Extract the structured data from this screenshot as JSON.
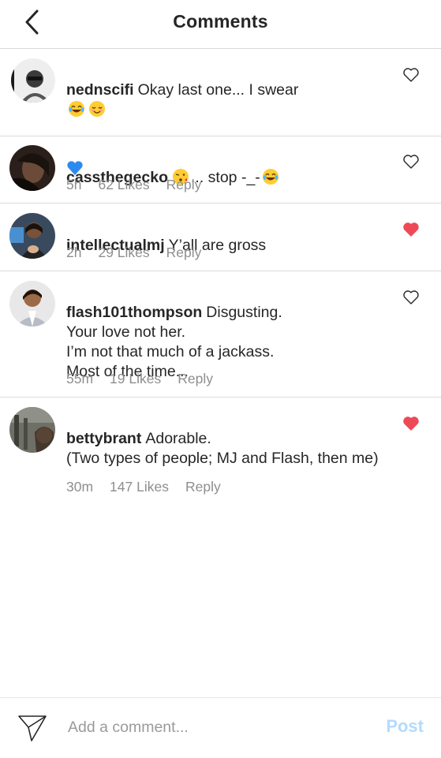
{
  "header": {
    "title": "Comments"
  },
  "caption": {
    "username": "nednscifi",
    "text": "Okay last one... I swear"
  },
  "comments": [
    {
      "username": "cassthegecko",
      "text_after_emoji": "... stop -_-",
      "time": "5h",
      "likes": "62 Likes",
      "reply": "Reply",
      "liked": false
    },
    {
      "username": "intellectualmj",
      "text": "Y’all are gross",
      "time": "2h",
      "likes": "29 Likes",
      "reply": "Reply",
      "liked": true
    },
    {
      "username": "flash101thompson",
      "text": "Disgusting.\nYour love not her.\nI’m not that much of a jackass.\nMost of the time...",
      "time": "55m",
      "likes": "19 Likes",
      "reply": "Reply",
      "liked": false
    },
    {
      "username": "bettybrant",
      "text": "Adorable.\n(Two types of people; MJ and Flash, then me)",
      "time": "30m",
      "likes": "147 Likes",
      "reply": "Reply",
      "liked": true
    }
  ],
  "footer": {
    "placeholder": "Add a comment...",
    "post_label": "Post"
  },
  "colors": {
    "liked_heart": "#ed4956",
    "post_disabled": "#b3dbff",
    "meta_text": "#8e8e8e"
  },
  "icons": {
    "back": "chevron-left-icon",
    "heart": "heart-icon",
    "send": "paper-plane-icon"
  }
}
